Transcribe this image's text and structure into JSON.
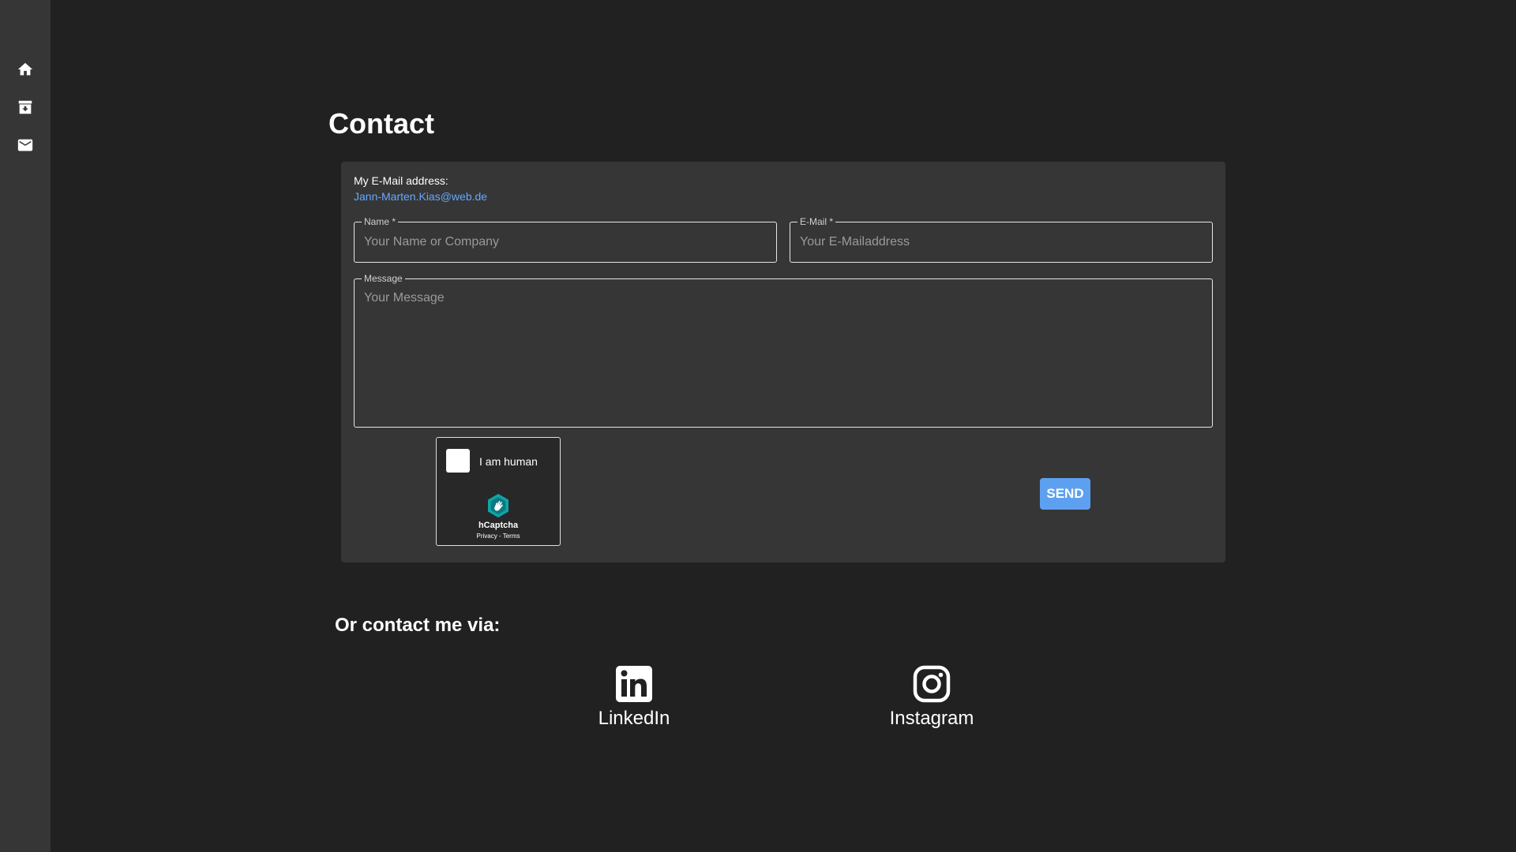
{
  "sidebar": {
    "items": [
      {
        "icon": "home-icon"
      },
      {
        "icon": "archive-icon"
      },
      {
        "icon": "mail-icon"
      }
    ]
  },
  "page": {
    "title": "Contact"
  },
  "contact_card": {
    "email_label": "My E-Mail address:",
    "email_value": "Jann-Marten.Kias@web.de",
    "fields": {
      "name": {
        "label": "Name *",
        "placeholder": "Your Name or Company",
        "value": ""
      },
      "email": {
        "label": "E-Mail *",
        "placeholder": "Your E-Mailaddress",
        "value": ""
      },
      "message": {
        "label": "Message",
        "placeholder": "Your Message",
        "value": ""
      }
    },
    "captcha": {
      "label": "I am human",
      "brand": "hCaptcha",
      "privacy": "Privacy",
      "separator": " - ",
      "terms": "Terms",
      "logo_icon": "hcaptcha-logo-icon"
    },
    "send_label": "SEND"
  },
  "alternatives": {
    "heading": "Or contact me via:",
    "links": [
      {
        "label": "LinkedIn",
        "icon": "linkedin-icon"
      },
      {
        "label": "Instagram",
        "icon": "instagram-icon"
      }
    ]
  },
  "colors": {
    "background": "#212121",
    "sidebar": "#363636",
    "card": "#363636",
    "accent": "#5ea0f0",
    "link": "#64a8ff"
  }
}
